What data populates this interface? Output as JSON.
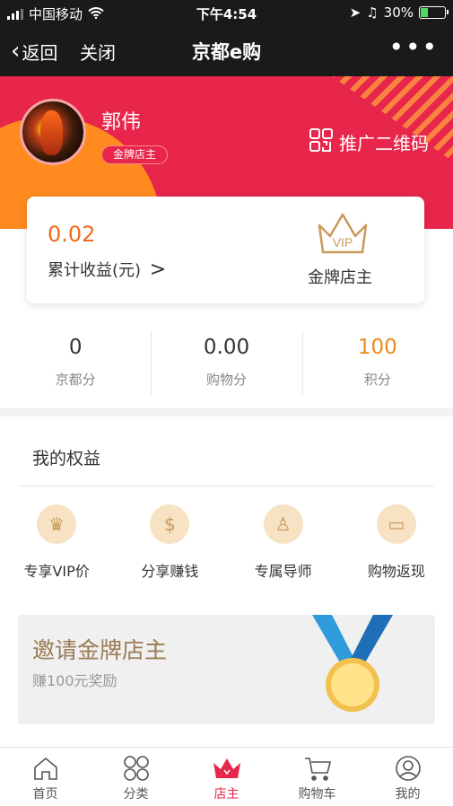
{
  "status": {
    "carrier": "中国移动",
    "time": "下午4:54",
    "battery": "30%"
  },
  "nav": {
    "back": "返回",
    "close": "关闭",
    "title": "京都e购",
    "more": "•••"
  },
  "profile": {
    "name": "郭伟",
    "badge": "金牌店主",
    "qr_label": "推广二维码"
  },
  "earnings": {
    "amount": "0.02",
    "label": "累计收益(元)",
    "arrow": ">",
    "vip_text": "VIP",
    "tier": "金牌店主"
  },
  "stats": [
    {
      "value": "0",
      "label": "京都分",
      "color": "#333333"
    },
    {
      "value": "0.00",
      "label": "购物分",
      "color": "#333333"
    },
    {
      "value": "100",
      "label": "积分",
      "color": "#ef8a1e"
    }
  ],
  "benefits_title": "我的权益",
  "benefits": [
    {
      "label": "专享VIP价",
      "icon": "crown-icon",
      "glyph": "♛"
    },
    {
      "label": "分享赚钱",
      "icon": "dollar-icon",
      "glyph": "$"
    },
    {
      "label": "专属导师",
      "icon": "mentor-icon",
      "glyph": "♙"
    },
    {
      "label": "购物返现",
      "icon": "wallet-icon",
      "glyph": "▭"
    }
  ],
  "invite": {
    "title": "邀请金牌店主",
    "subtitle": "赚100元奖励"
  },
  "tabs": [
    {
      "label": "首页",
      "icon": "home-icon",
      "active": false
    },
    {
      "label": "分类",
      "icon": "category-icon",
      "active": false
    },
    {
      "label": "店主",
      "icon": "shop-owner-icon",
      "active": true
    },
    {
      "label": "购物车",
      "icon": "cart-icon",
      "active": false
    },
    {
      "label": "我的",
      "icon": "profile-icon",
      "active": false
    }
  ],
  "colors": {
    "brand_red": "#e8254a",
    "accent_orange": "#ef6a1e",
    "gold": "#c89a5a"
  }
}
